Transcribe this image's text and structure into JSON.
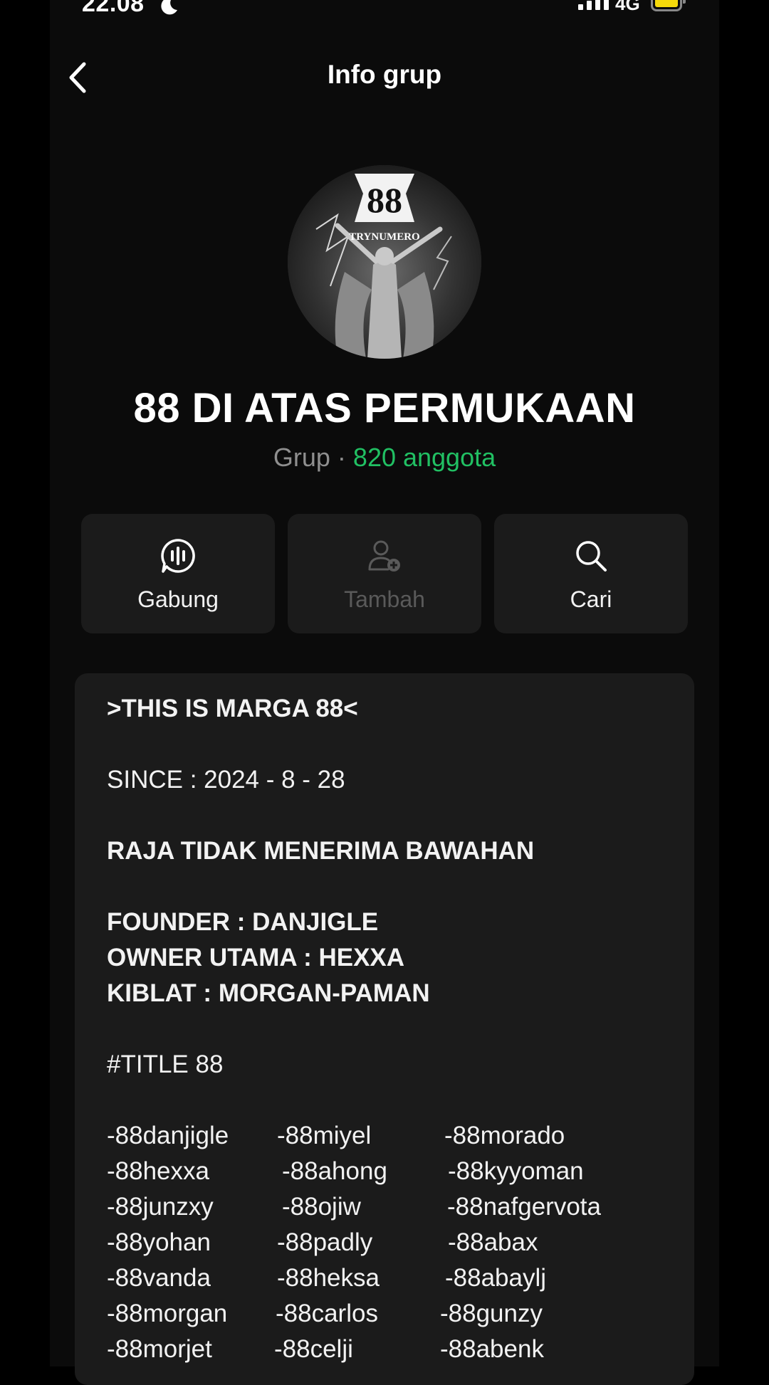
{
  "status_bar": {
    "time": "22.08",
    "network": "4G",
    "icons": [
      "moon-icon",
      "signal-icon",
      "battery-icon"
    ],
    "battery_color": "#f5d90a"
  },
  "header": {
    "title": "Info grup",
    "back_icon": "chevron-left-icon"
  },
  "group": {
    "avatar_text": "88",
    "avatar_subtext": "TRYNUMERO",
    "name": "88 DI ATAS PERMUKAAN",
    "type_label": "Grup ·",
    "members": "820 anggota",
    "members_color": "#21c063"
  },
  "actions": [
    {
      "label": "Gabung",
      "icon": "voice-chat-icon",
      "enabled": true
    },
    {
      "label": "Tambah",
      "icon": "add-person-icon",
      "enabled": false
    },
    {
      "label": "Cari",
      "icon": "search-icon",
      "enabled": true
    }
  ],
  "description": {
    "heading": ">THIS IS MARGA 88<",
    "since": "SINCE : 2024 - 8 - 28",
    "motto": "RAJA TIDAK MENERIMA BAWAHAN",
    "founder": "FOUNDER : DANJIGLE",
    "owner": "OWNER UTAMA : HEXXA",
    "kiblat": "KIBLAT : MORGAN-PAMAN",
    "title_tag": "#TITLE 88",
    "members": [
      [
        "-88danjigle",
        "-88miyel",
        "-88morado"
      ],
      [
        "-88hexxa",
        "-88ahong",
        "-88kyyoman"
      ],
      [
        "-88junzxy",
        "-88ojiw",
        "-88nafgervota"
      ],
      [
        "-88yohan",
        "-88padly",
        "-88abax"
      ],
      [
        "-88vanda",
        "-88heksa",
        "-88abaylj"
      ],
      [
        "-88morgan",
        "-88carlos",
        "-88gunzy"
      ],
      [
        "-88morjet",
        "-88celji",
        "-88abenk"
      ]
    ]
  }
}
